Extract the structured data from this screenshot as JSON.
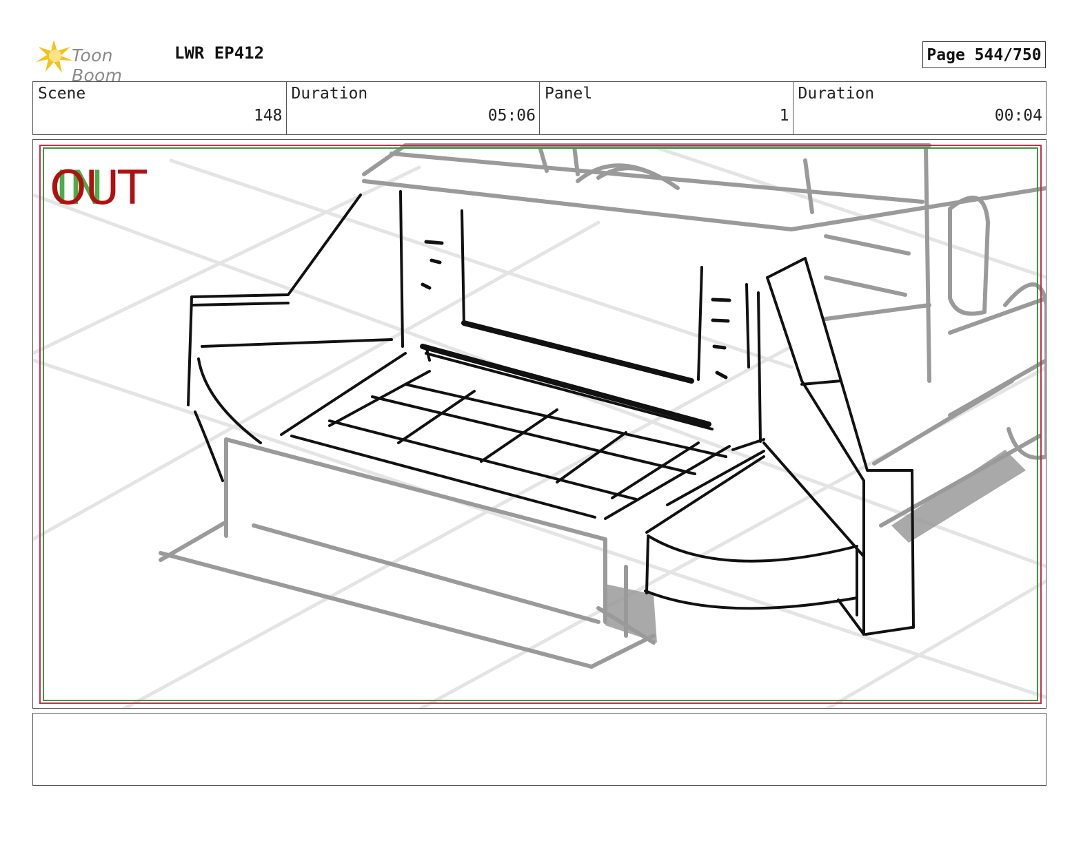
{
  "header": {
    "logo_text": "Toon Boom",
    "project_title": "LWR EP412",
    "page_label": "Page 544/750"
  },
  "info": [
    {
      "label": "Scene",
      "value": "148"
    },
    {
      "label": "Duration",
      "value": "05:06"
    },
    {
      "label": "Panel",
      "value": "1"
    },
    {
      "label": "Duration",
      "value": "00:04"
    }
  ],
  "panel": {
    "out_marker": "OUT",
    "in_marker": "IN"
  },
  "notes": {
    "text": ""
  },
  "colors": {
    "out_marker": "#b01010",
    "in_marker": "#2aa02a",
    "safe_frame_green": "#3a9a3a",
    "safe_frame_red": "#c03050",
    "sketch_dark": "#111111",
    "sketch_grey": "#9a9a9a",
    "logo_star": "#f2c418"
  }
}
